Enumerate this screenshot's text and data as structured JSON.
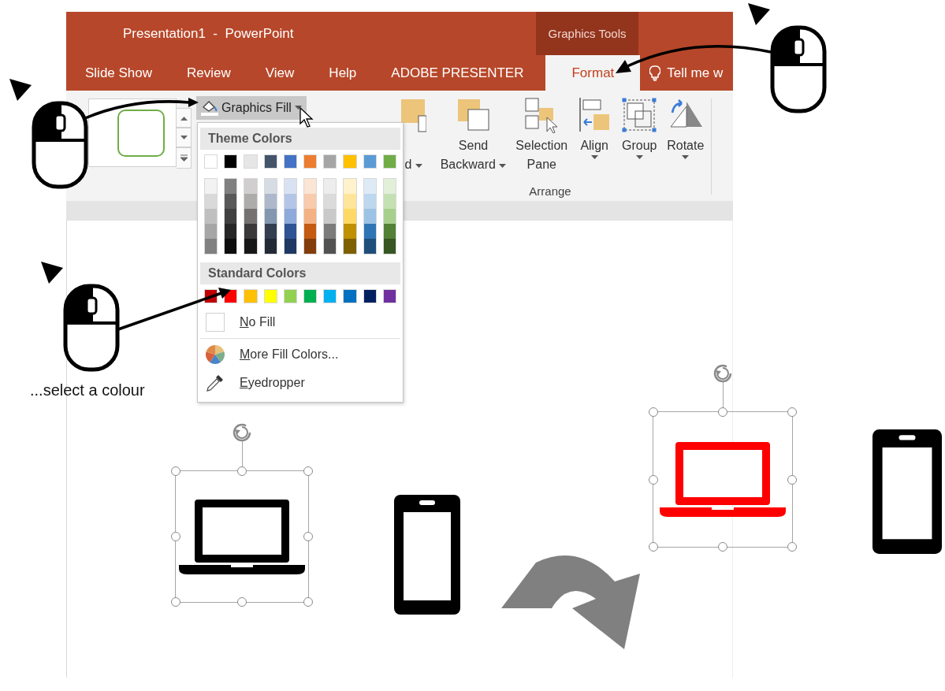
{
  "window": {
    "title": "Presentation1  -  PowerPoint",
    "context_group": "Graphics Tools"
  },
  "tabs": [
    {
      "label": "Slide Show",
      "selected": false
    },
    {
      "label": "Review",
      "selected": false
    },
    {
      "label": "View",
      "selected": false
    },
    {
      "label": "Help",
      "selected": false
    },
    {
      "label": "ADOBE PRESENTER",
      "selected": false
    },
    {
      "label": "Format",
      "selected": true
    }
  ],
  "tell_me": {
    "placeholder": "Tell me w"
  },
  "fill_button": {
    "label": "Graphics Fill"
  },
  "arrange": {
    "label": "Arrange",
    "buttons": [
      {
        "kind": "bring_forward",
        "lines": [
          "d"
        ],
        "dropdown": true,
        "caret_inline": true
      },
      {
        "kind": "send_backward",
        "lines": [
          "Send",
          "Backward"
        ],
        "dropdown": true,
        "caret_inline": true
      },
      {
        "kind": "selection_pane",
        "lines": [
          "Selection",
          "Pane"
        ],
        "dropdown": false
      },
      {
        "kind": "align",
        "lines": [
          "Align"
        ],
        "dropdown": true,
        "caret_inline": false
      },
      {
        "kind": "group",
        "lines": [
          "Group"
        ],
        "dropdown": true,
        "caret_inline": false
      },
      {
        "kind": "rotate",
        "lines": [
          "Rotate"
        ],
        "dropdown": true,
        "caret_inline": false
      }
    ]
  },
  "fill_menu": {
    "theme_header": "Theme Colors",
    "theme_colors": [
      {
        "color": "#ffffff"
      },
      {
        "color": "#000000"
      },
      {
        "color": "#e7e6e6"
      },
      {
        "color": "#44546a"
      },
      {
        "color": "#4472c4"
      },
      {
        "color": "#ed7d31"
      },
      {
        "color": "#a5a5a5"
      },
      {
        "color": "#ffc000"
      },
      {
        "color": "#5b9bd5"
      },
      {
        "color": "#70ad47"
      }
    ],
    "theme_shades": [
      [
        {
          "color": "#f2f2f2"
        },
        {
          "color": "#d9d9d9"
        },
        {
          "color": "#bfbfbf"
        },
        {
          "color": "#a6a6a6"
        },
        {
          "color": "#808080"
        }
      ],
      [
        {
          "color": "#808080"
        },
        {
          "color": "#595959"
        },
        {
          "color": "#404040"
        },
        {
          "color": "#262626"
        },
        {
          "color": "#0d0d0d"
        }
      ],
      [
        {
          "color": "#d0cece"
        },
        {
          "color": "#aeabab"
        },
        {
          "color": "#757171"
        },
        {
          "color": "#3a3838"
        },
        {
          "color": "#181717"
        }
      ],
      [
        {
          "color": "#d6dce4"
        },
        {
          "color": "#adb9ca"
        },
        {
          "color": "#8497b0"
        },
        {
          "color": "#333f4f"
        },
        {
          "color": "#222a35"
        }
      ],
      [
        {
          "color": "#d9e2f3"
        },
        {
          "color": "#b4c6e7"
        },
        {
          "color": "#8eaadb"
        },
        {
          "color": "#2f5496"
        },
        {
          "color": "#1f3864"
        }
      ],
      [
        {
          "color": "#fbe5d5"
        },
        {
          "color": "#f7cbac"
        },
        {
          "color": "#f4b183"
        },
        {
          "color": "#c55a11"
        },
        {
          "color": "#833c0b"
        }
      ],
      [
        {
          "color": "#ededed"
        },
        {
          "color": "#dbdbdb"
        },
        {
          "color": "#c9c9c9"
        },
        {
          "color": "#7b7b7b"
        },
        {
          "color": "#525252"
        }
      ],
      [
        {
          "color": "#fff2cc"
        },
        {
          "color": "#fee599"
        },
        {
          "color": "#ffd965"
        },
        {
          "color": "#bf9000"
        },
        {
          "color": "#7f6000"
        }
      ],
      [
        {
          "color": "#deebf6"
        },
        {
          "color": "#bdd7ee"
        },
        {
          "color": "#9cc3e5"
        },
        {
          "color": "#2e75b5"
        },
        {
          "color": "#1e4e79"
        }
      ],
      [
        {
          "color": "#e2efd9"
        },
        {
          "color": "#c5e0b3"
        },
        {
          "color": "#a8d08d"
        },
        {
          "color": "#538135"
        },
        {
          "color": "#375623"
        }
      ]
    ],
    "standard_header": "Standard Colors",
    "standard_colors": [
      {
        "color": "#c00000"
      },
      {
        "color": "#ff0000"
      },
      {
        "color": "#ffc000"
      },
      {
        "color": "#ffff00"
      },
      {
        "color": "#92d050"
      },
      {
        "color": "#00b050"
      },
      {
        "color": "#00b0f0"
      },
      {
        "color": "#0070c0"
      },
      {
        "color": "#002060"
      },
      {
        "color": "#7030a0"
      }
    ],
    "items": [
      {
        "kind": "no_fill",
        "label": "No Fill"
      },
      {
        "kind": "more_colors",
        "label": "More Fill Colors..."
      },
      {
        "kind": "eyedropper",
        "label": "Eyedropper"
      }
    ]
  },
  "caption": "...select a colour",
  "scenes": [
    {
      "laptop": {
        "color": "#000000",
        "selected": true
      }
    },
    {
      "laptop": {
        "color": "#ff0000",
        "selected": true
      }
    }
  ]
}
